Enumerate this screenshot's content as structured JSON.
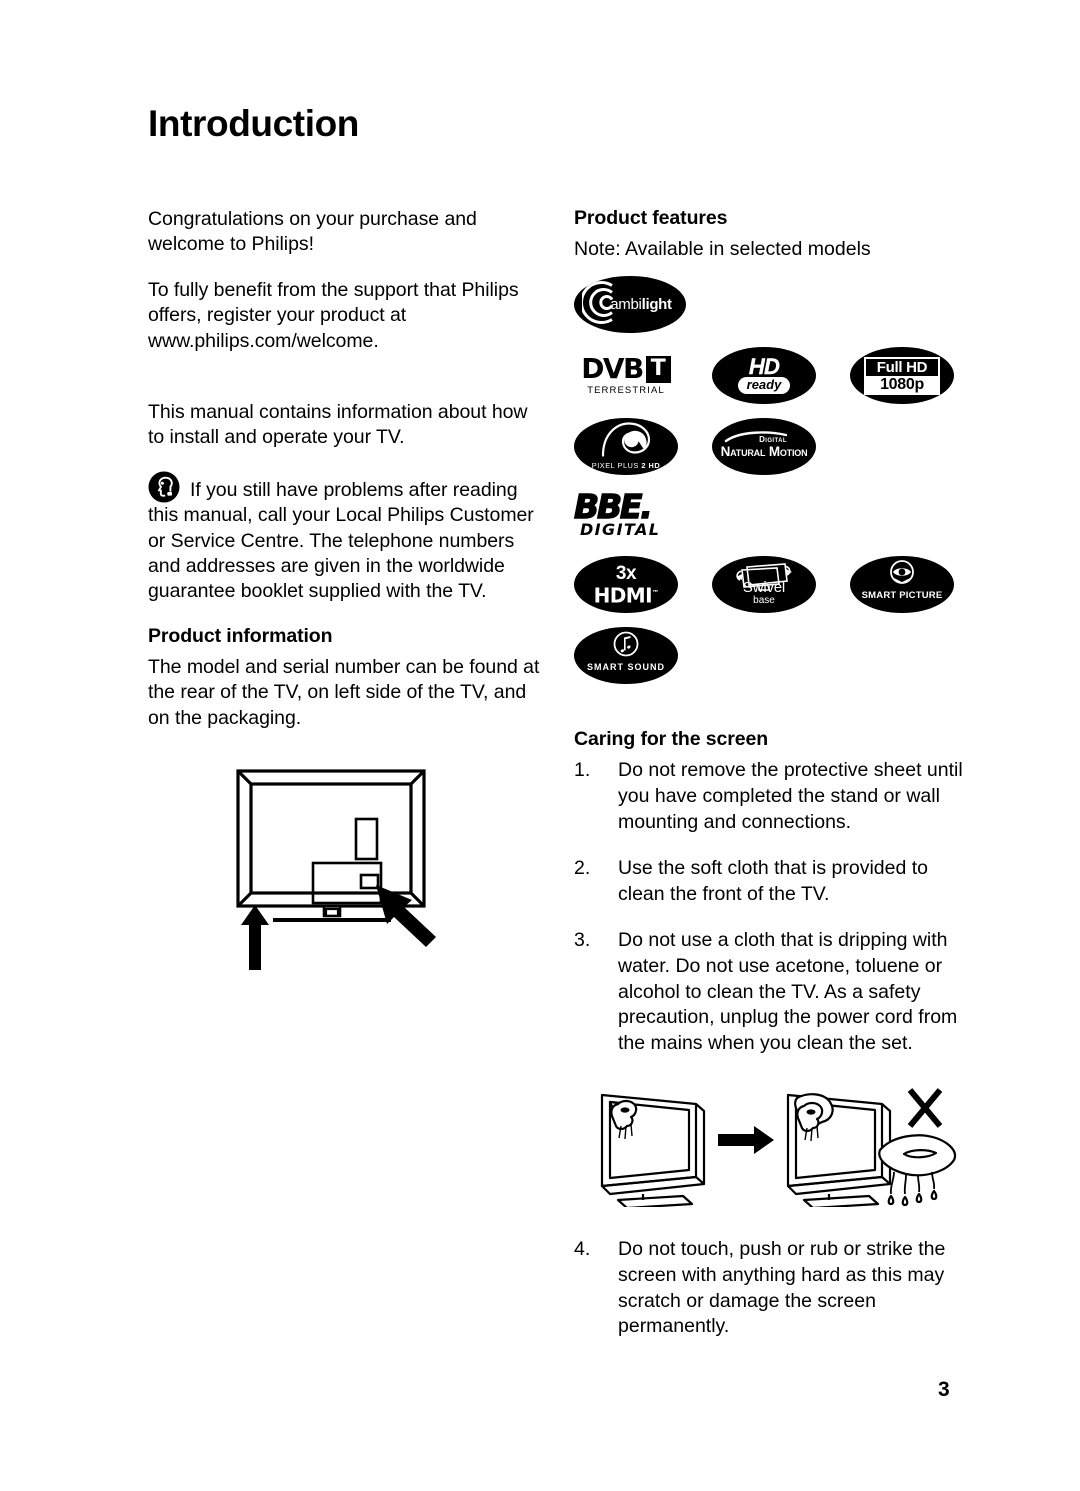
{
  "document": {
    "title": "Introduction",
    "page_number": "3"
  },
  "left_column": {
    "intro_paragraph": "Congratulations on your purchase and welcome to Philips!",
    "register_paragraph": "To fully benefit from the support that Philips offers, register your product at www.philips.com/welcome.",
    "manual_paragraph": "This manual contains information about how to install and operate your TV.",
    "support_icon": "headset-support-icon",
    "support_paragraph": "If you still have problems after reading this manual, call your Local Philips Customer or Service Centre. The telephone numbers and addresses are given in the worldwide guarantee booklet supplied with the TV.",
    "product_information": {
      "heading": "Product information",
      "body": "The model and serial number can be found at the rear of the TV, on left side of the TV, and on the packaging."
    },
    "figure": {
      "name": "tv-rear-view-diagram",
      "description": "Rear view of television showing label locations indicated by two arrows"
    }
  },
  "right_column": {
    "product_features": {
      "heading": "Product features",
      "note": "Note: Available in selected models",
      "logos": [
        {
          "id": "ambilight",
          "line1": "ambi",
          "line2": "light"
        },
        {
          "id": "dvb-t",
          "line1": "DVB",
          "badge": "T",
          "line2": "TERRESTRIAL"
        },
        {
          "id": "hd-ready",
          "line1": "HD",
          "line2": "ready"
        },
        {
          "id": "full-hd-1080p",
          "line1": "Full HD",
          "line2": "1080p"
        },
        {
          "id": "pixel-plus-2-hd",
          "line1": "PIXEL PLUS",
          "line2": "2 HD"
        },
        {
          "id": "digital-natural-motion",
          "line1": "Digital",
          "line2": "Natural Motion"
        },
        {
          "id": "bbe-digital",
          "line1": "BBE",
          "line2": "DIGITAL"
        },
        {
          "id": "hdmi-3x",
          "line1": "3x",
          "line2": "HDMI"
        },
        {
          "id": "swivel-base",
          "line1": "Swivel",
          "line2": "base"
        },
        {
          "id": "smart-picture",
          "line1": "SMART PICTURE"
        },
        {
          "id": "smart-sound",
          "line1": "SMART SOUND"
        }
      ]
    },
    "caring_for_screen": {
      "heading": "Caring for the screen",
      "items": [
        {
          "num": "1.",
          "text": "Do not remove the protective sheet until you have completed the stand or wall mounting and connections."
        },
        {
          "num": "2.",
          "text": "Use the soft cloth that is provided to clean the front of the TV."
        },
        {
          "num": "3.",
          "text": "Do not use a cloth that is dripping with water. Do not use acetone, toluene or alcohol to clean the TV. As a safety precaution, unplug the power cord from the mains when you clean the set."
        },
        {
          "num": "4.",
          "text": "Do not touch, push or rub or strike the screen with anything hard as this may scratch or damage the screen permanently."
        }
      ],
      "figure": {
        "name": "screen-cleaning-diagram",
        "description": "Remove protective sheet, wipe screen with soft cloth, do not use dripping wet cloth"
      }
    }
  },
  "colors": {
    "text": "#000000",
    "background": "#ffffff",
    "logo_fill": "#000000"
  }
}
